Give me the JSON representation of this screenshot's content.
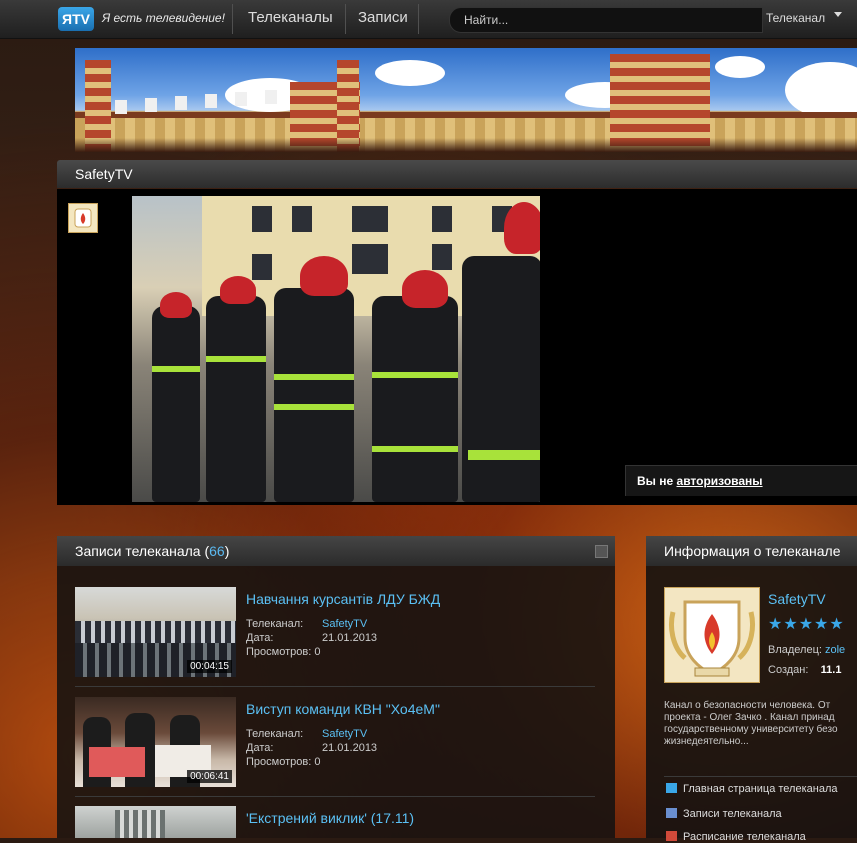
{
  "topbar": {
    "logo_text": "ЯTV",
    "slogan": "Я есть телевидение!",
    "nav": [
      {
        "label": "Телеканалы"
      },
      {
        "label": "Записи"
      }
    ],
    "search_placeholder": "Найти...",
    "search_scope": "Телеканал"
  },
  "channel": {
    "title": "SafetyTV"
  },
  "player": {
    "not_logged_prefix": "Вы не ",
    "not_logged_link": "авторизованы"
  },
  "recordings": {
    "heading": "Записи телеканала (",
    "count": "66",
    "heading_close": ")",
    "items": [
      {
        "title": "Навчання курсантів ЛДУ БЖД",
        "channel_label": "Телеканал:",
        "channel_value": "SafetyTV",
        "date_label": "Дата:",
        "date_value": "21.01.2013",
        "views_label": "Просмотров:",
        "views_value": "0",
        "duration": "00:04:15"
      },
      {
        "title": "Виступ команди КВН \"Хо4еМ\"",
        "channel_label": "Телеканал:",
        "channel_value": "SafetyTV",
        "date_label": "Дата:",
        "date_value": "21.01.2013",
        "views_label": "Просмотров:",
        "views_value": "0",
        "duration": "00:06:41"
      },
      {
        "title": "'Екстрений виклик' (17.11)"
      }
    ]
  },
  "info": {
    "heading": "Информация о телеканале",
    "name": "SafetyTV",
    "stars": "★★★★★",
    "owner_label": "Владелец:",
    "owner_value": "zole",
    "created_label": "Создан:",
    "created_value": "11.1",
    "description": "Канал о безопасности человека. От проекта - Олег Зачко . Канал принад государственному университету безо жизнедеятельно...",
    "links": [
      {
        "label": "Главная страница телеканала",
        "color": "#3aa7e8"
      },
      {
        "label": "Записи телеканала",
        "color": "#6a8fd0"
      },
      {
        "label": "Расписание телеканала",
        "color": "#d04a3a"
      }
    ]
  },
  "colors": {
    "accent": "#5bc0f4",
    "logo": "#2a8ad0"
  }
}
